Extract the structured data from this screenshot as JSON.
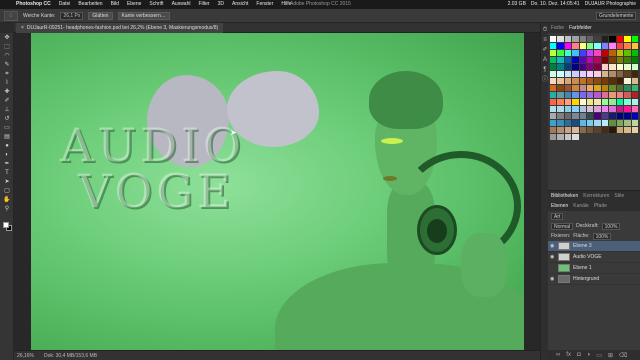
{
  "menubar": {
    "app": "Photoshop CC",
    "items": [
      "Datei",
      "Bearbeiten",
      "Bild",
      "Ebene",
      "Schrift",
      "Auswahl",
      "Filter",
      "3D",
      "Ansicht",
      "Fenster",
      "Hilfe"
    ],
    "window_title": "Adobe Photoshop CC 2015",
    "status_items": [
      "2.03 GB",
      "Do. 10. Dez. 14:05:41",
      "DUJAUR Photographie"
    ]
  },
  "options": {
    "feather_label": "Weiche Kante:",
    "feather_value": "26,1 Px",
    "smooth_label": "Glätten",
    "refine_label": "Kante verbessern…",
    "workspace": "Grundelemente"
  },
  "document": {
    "tab_title": "DUJaurR-09251- headphones-fashion.psd bei 26,2% (Ebene 3, Maskierungsmodus/8)"
  },
  "canvas": {
    "text_line1": "AUDIO",
    "text_line2": "VOGE"
  },
  "statusbar": {
    "zoom": "26,16%",
    "doc_size": "Dok: 30,4 MB/153,6 MB"
  },
  "panels": {
    "tabs": [
      "Farbe",
      "Farbfelder"
    ],
    "active_tab": "Farbfelder",
    "swatch_colors": [
      "#ffffff",
      "#e0e0e0",
      "#c0c0c0",
      "#a0a0a0",
      "#808080",
      "#606060",
      "#404040",
      "#202020",
      "#000000",
      "#ff0000",
      "#ffff00",
      "#00ff00",
      "#00ffff",
      "#0000ff",
      "#ff00ff",
      "#ff8080",
      "#ffff80",
      "#80ff80",
      "#80ffff",
      "#8080ff",
      "#ff80ff",
      "#ff4040",
      "#ff8040",
      "#ffc040",
      "#c0ff40",
      "#40ff40",
      "#40ffc0",
      "#40c0ff",
      "#4040ff",
      "#c040ff",
      "#ff40c0",
      "#c00000",
      "#c06000",
      "#c0c000",
      "#60c000",
      "#00c000",
      "#00c060",
      "#00c0c0",
      "#0060c0",
      "#0000c0",
      "#6000c0",
      "#c000c0",
      "#c00060",
      "#800000",
      "#804000",
      "#808000",
      "#408000",
      "#008000",
      "#008040",
      "#008080",
      "#004080",
      "#000080",
      "#400080",
      "#800080",
      "#800040",
      "#ffcccc",
      "#ffe5cc",
      "#ffffcc",
      "#e5ffcc",
      "#ccffcc",
      "#ccffe5",
      "#ccffff",
      "#cce5ff",
      "#ccccff",
      "#e5ccff",
      "#ffccff",
      "#ffcce5",
      "#d9b38c",
      "#b38c66",
      "#8c6640",
      "#664019",
      "#40260d",
      "#f2d9bf",
      "#e6c299",
      "#d9a673",
      "#cc8c4d",
      "#bf7326",
      "#a65c1a",
      "#8c4d13",
      "#733d0d",
      "#592e08",
      "#402004",
      "#f5f5dc",
      "#deb887",
      "#d2691e",
      "#8b4513",
      "#a0522d",
      "#cd853f",
      "#bc8f8f",
      "#f4a460",
      "#daa520",
      "#b8860b",
      "#6b8e23",
      "#556b2f",
      "#2e8b57",
      "#3cb371",
      "#20b2aa",
      "#5f9ea0",
      "#4682b4",
      "#6495ed",
      "#7b68ee",
      "#9370db",
      "#ba55d3",
      "#db7093",
      "#e9967a",
      "#f08080",
      "#cd5c5c",
      "#b22222",
      "#ff6347",
      "#ff7f50",
      "#ffa07a",
      "#ffd700",
      "#fffacd",
      "#f0e68c",
      "#eee8aa",
      "#98fb98",
      "#90ee90",
      "#00fa9a",
      "#7fffd4",
      "#afeeee",
      "#b0e0e6",
      "#add8e6",
      "#87ceeb",
      "#87cefa",
      "#b0c4de",
      "#d8bfd8",
      "#dda0dd",
      "#ee82ee",
      "#da70d6",
      "#c71585",
      "#ff1493",
      "#ff69b4",
      "#a9a9a9",
      "#808080",
      "#696969",
      "#778899",
      "#708090",
      "#2f4f4f",
      "#4b0082",
      "#483d8b",
      "#191970",
      "#000080",
      "#00008b",
      "#0000cd",
      "#41a0cd",
      "#3a8dbd",
      "#2a6d9d",
      "#1a4d7d",
      "#5ab9e5",
      "#7cc9ec",
      "#9dd9f2",
      "#bfe8f8",
      "#5f8f3f",
      "#7fa65f",
      "#9fbd7f",
      "#bfd49f",
      "#a37a5a",
      "#b58f70",
      "#c7a486",
      "#d9b99c",
      "#8a6a4a",
      "#735539",
      "#5c4029",
      "#452b19",
      "#2e160a",
      "#c8a870",
      "#d8bb88",
      "#e8cea0",
      "#9a9a9a",
      "#b0b0b0",
      "#c6c6c6",
      "#dcdcdc"
    ]
  },
  "layers_panel": {
    "tabs": [
      "Ebenen",
      "Kanäle",
      "Pfade"
    ],
    "upper_tabs": [
      "Bibliotheken",
      "Korrekturen",
      "Stile"
    ],
    "filter_label": "Art",
    "blend_mode": "Normal",
    "opacity_label": "Deckkraft:",
    "opacity_value": "100%",
    "lock_label": "Fixieren:",
    "fill_label": "Fläche:",
    "fill_value": "100%",
    "layers": [
      {
        "name": "Ebene 3",
        "selected": true
      },
      {
        "name": "Audio VOGE",
        "selected": false
      },
      {
        "name": "Ebene 1",
        "selected": false
      },
      {
        "name": "Hintergrund",
        "selected": false
      }
    ]
  }
}
